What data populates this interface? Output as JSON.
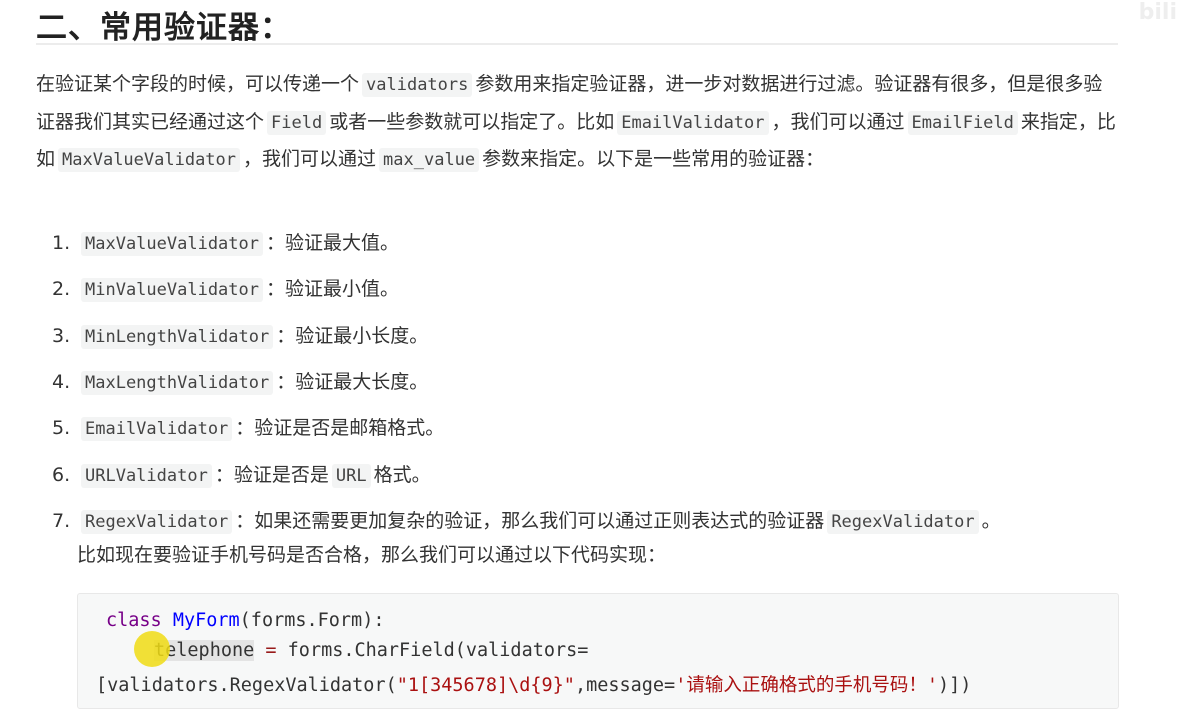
{
  "heading": "二、常用验证器：",
  "paragraph": [
    {
      "t": "在验证某个字段的时候，可以传递一个"
    },
    {
      "c": "validators"
    },
    {
      "t": "参数用来指定验证器，进一步对数据进行过滤。验证器有很多，但是很多验证器我们其实已经通过这个"
    },
    {
      "c": "Field"
    },
    {
      "t": "或者一些参数就可以指定了。比如"
    },
    {
      "c": "EmailValidator"
    },
    {
      "t": "，我们可以通过"
    },
    {
      "c": "EmailField"
    },
    {
      "t": "来指定，比如"
    },
    {
      "c": "MaxValueValidator"
    },
    {
      "t": "，我们可以通过"
    },
    {
      "c": "max_value"
    },
    {
      "t": "参数来指定。以下是一些常用的验证器："
    }
  ],
  "validators": [
    {
      "num": "1.",
      "name": "MaxValueValidator",
      "desc": "：验证最大值。"
    },
    {
      "num": "2.",
      "name": "MinValueValidator",
      "desc": "：验证最小值。"
    },
    {
      "num": "3.",
      "name": "MinLengthValidator",
      "desc": "：验证最小长度。"
    },
    {
      "num": "4.",
      "name": "MaxLengthValidator",
      "desc": "：验证最大长度。"
    },
    {
      "num": "5.",
      "name": "EmailValidator",
      "desc": "：验证是否是邮箱格式。"
    },
    {
      "num": "6.",
      "name": "URLValidator",
      "desc": "：验证是否是",
      "code2": "URL",
      "desc2": "格式。"
    },
    {
      "num": "7.",
      "name": "RegexValidator",
      "desc": "：如果还需要更加复杂的验证，那么我们可以通过正则表达式的验证器",
      "code2": "RegexValidator",
      "desc2": "。"
    }
  ],
  "item7_continuation": "比如现在要验证手机号码是否合格，那么我们可以通过以下代码实现：",
  "code": {
    "line1": {
      "kw": "class",
      "cls": "MyForm",
      "rest": "(forms.Form):"
    },
    "line2": {
      "var": "telephone",
      "op": "=",
      "rest": " forms.CharField(validators="
    },
    "line3": {
      "pre": "[validators.RegexValidator(",
      "str1": "\"1[345678]\\d{9}\"",
      "mid": ",message=",
      "str2": "'请输入正确格式的手机号码！'",
      "post": ")])"
    }
  },
  "watermark": "bili"
}
